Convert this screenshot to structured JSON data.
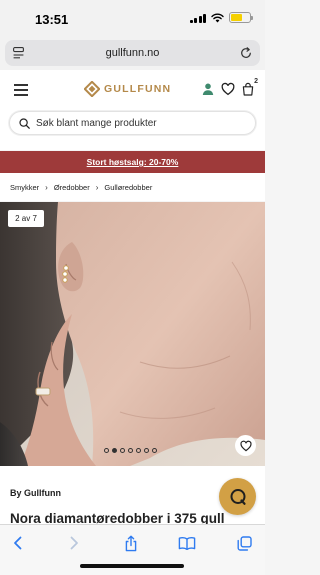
{
  "status_bar": {
    "time": "13:51",
    "icons": [
      "signal-icon",
      "wifi-icon",
      "battery-icon"
    ],
    "battery_color": "#f5d000"
  },
  "browser": {
    "url": "gullfunn.no",
    "left_icon": "page-menu-icon",
    "right_icon": "reload-icon"
  },
  "header": {
    "logo_text": "GULLFUNN",
    "brand_color": "#b4894a",
    "icons": [
      "menu-icon",
      "account-icon",
      "heart-icon",
      "cart-icon"
    ],
    "cart_count": "2",
    "search_placeholder": "Søk blant mange produkter"
  },
  "promo": {
    "text": "Stort høstsalg: 20-70%",
    "background": "#9e3a3a"
  },
  "breadcrumb": {
    "items": [
      "Smykker",
      "Øredobber",
      "Gulløredobber"
    ],
    "separator": "›"
  },
  "gallery": {
    "counter": "2 av 7",
    "total_images": 7,
    "active_index": 2
  },
  "product": {
    "brand": "By Gullfunn",
    "title": "Nora diamantøredobber i 375 gull"
  },
  "chat": {
    "icon": "chat-icon",
    "color": "#d2a045"
  },
  "toolbar": {
    "icons": [
      "back-icon",
      "forward-icon",
      "share-icon",
      "bookmarks-icon",
      "tabs-icon"
    ],
    "accent": "#2f7bf0"
  }
}
